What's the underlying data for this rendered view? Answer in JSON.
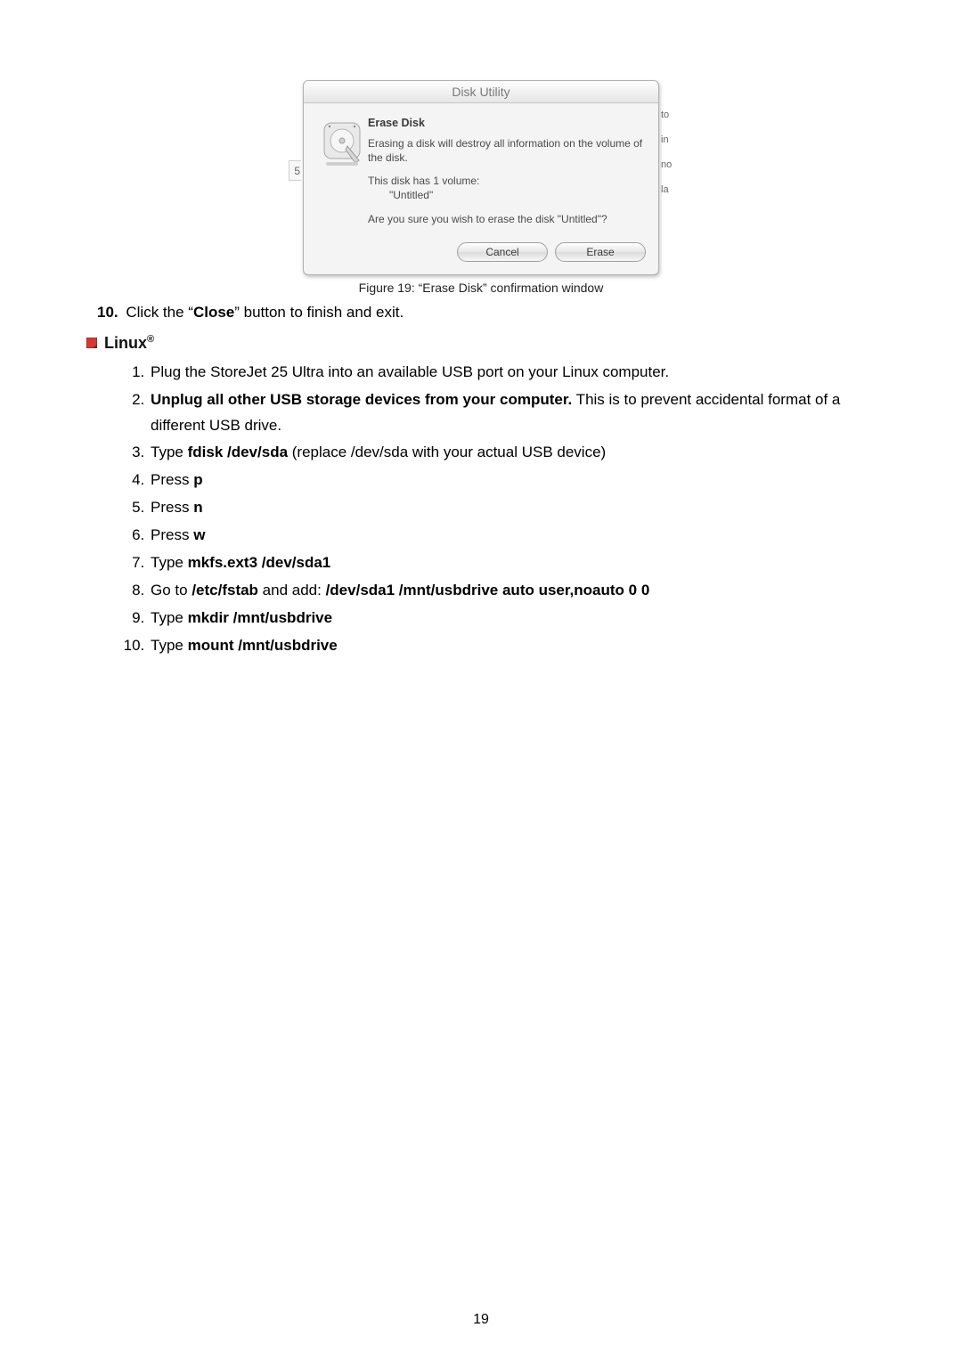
{
  "dialog": {
    "window_title": "Disk Utility",
    "heading": "Erase Disk",
    "line1": "Erasing a disk will destroy all information on the volume of the disk.",
    "vol_intro": "This disk has 1 volume:",
    "vol_name": "\"Untitled\"",
    "question": "Are you sure you wish to erase the disk \"Untitled\"?",
    "cancel": "Cancel",
    "erase": "Erase",
    "behind_left": "5",
    "behind_right": [
      "to",
      "in",
      "no",
      "la"
    ]
  },
  "figure_caption": "Figure 19: “Erase Disk” confirmation window",
  "step10": {
    "num": "10.",
    "pre": " Click the “",
    "bold": "Close",
    "post": "” button to finish and exit."
  },
  "section": {
    "title": "Linux",
    "sup": "®"
  },
  "steps": {
    "s1": "Plug the StoreJet 25 Ultra into an available USB port on your Linux computer.",
    "s2_bold": "Unplug all other USB storage devices from your computer.",
    "s2_rest": " This is to prevent accidental format of a different USB drive.",
    "s3_pre": "Type ",
    "s3_bold": "fdisk /dev/sda",
    "s3_post": " (replace /dev/sda with your actual USB device)",
    "s4_pre": "Press ",
    "s4_bold": "p",
    "s5_pre": "Press ",
    "s5_bold": "n",
    "s6_pre": "Press ",
    "s6_bold": "w",
    "s7_pre": "Type ",
    "s7_bold": "mkfs.ext3 /dev/sda1",
    "s8_pre": "Go to ",
    "s8_bold1": "/etc/fstab",
    "s8_mid": " and add: ",
    "s8_bold2": "/dev/sda1 /mnt/usbdrive auto user,noauto 0 0",
    "s9_pre": "Type ",
    "s9_bold": "mkdir /mnt/usbdrive",
    "s10_pre": "Type ",
    "s10_bold": "mount /mnt/usbdrive"
  },
  "page_number": "19"
}
